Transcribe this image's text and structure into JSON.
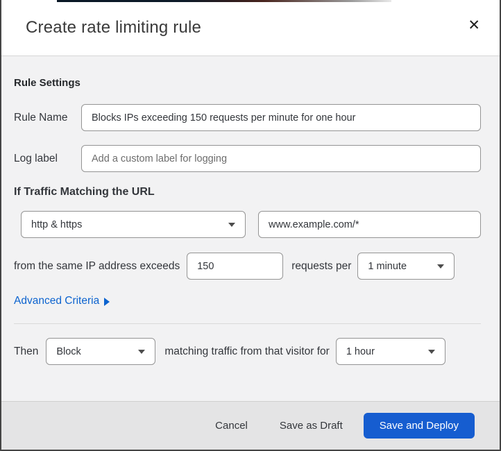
{
  "dialog": {
    "title": "Create rate limiting rule",
    "close_icon": "✕"
  },
  "colors": {
    "accent_link": "#0c63cf",
    "primary_button": "#165dd0",
    "body_background": "#f2f2f3",
    "footer_background": "#e4e4e5",
    "frame_border": "#454545"
  },
  "body": {
    "section_heading": "Rule Settings",
    "rule_name": {
      "label": "Rule Name",
      "value": "Blocks IPs exceeding 150 requests per minute for one hour"
    },
    "log_label": {
      "label": "Log label",
      "placeholder": "Add a custom label for logging"
    },
    "traffic_heading": "If Traffic Matching the URL",
    "scheme_select": {
      "value": "http & https"
    },
    "url_input": {
      "value": "www.example.com/*"
    },
    "threshold_row": {
      "prefix": "from the same IP address exceeds",
      "requests_value": "150",
      "middle": "requests per",
      "period_select": "1 minute"
    },
    "advanced_link": "Advanced Criteria",
    "then_row": {
      "prefix": "Then",
      "action_select": "Block",
      "middle": "matching traffic from that visitor for",
      "duration_select": "1 hour"
    }
  },
  "footer": {
    "cancel": "Cancel",
    "save_draft": "Save as Draft",
    "save_deploy": "Save and Deploy"
  }
}
